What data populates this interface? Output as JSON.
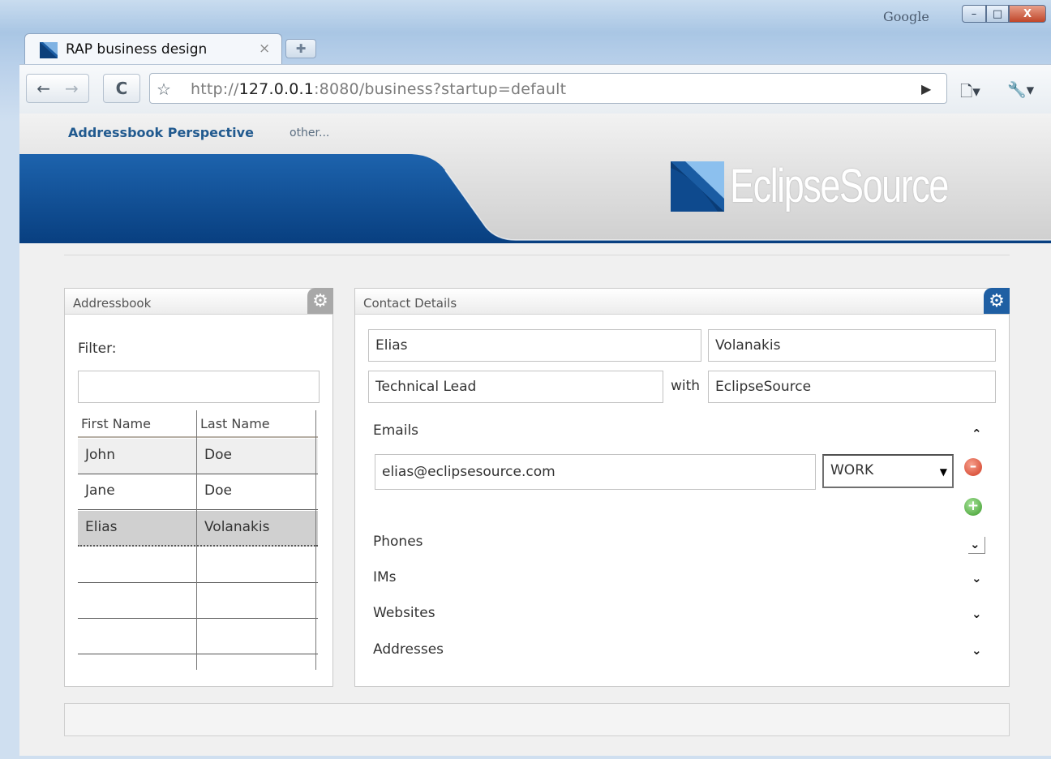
{
  "window": {
    "title_text": "Google",
    "controls": {
      "minimize": "–",
      "maximize": "□",
      "close": "X"
    }
  },
  "tab": {
    "title": "RAP business design",
    "close": "×",
    "new_tab": "✚"
  },
  "toolbar": {
    "back": "←",
    "forward": "→",
    "reload": "C",
    "star": "☆",
    "url_scheme": "http://",
    "url_host": "127.0.0.1",
    "url_rest": ":8080/business?startup=default",
    "go": "▶",
    "page_menu": "🗋▾",
    "wrench_menu": "🔧▾"
  },
  "header": {
    "perspective_link": "Addressbook Perspective",
    "other_link": "other...",
    "logo": "EclipseSource",
    "colors": {
      "banner_blue": "#0a4f96",
      "header_gray": "#d6d6d6"
    }
  },
  "addressbook": {
    "title": "Addressbook",
    "filter_label": "Filter:",
    "filter_value": "",
    "columns": [
      "First Name",
      "Last Name"
    ],
    "rows": [
      {
        "first": "John",
        "last": "Doe"
      },
      {
        "first": "Jane",
        "last": "Doe"
      },
      {
        "first": "Elias",
        "last": "Volanakis"
      }
    ],
    "selected_row": 2
  },
  "contact": {
    "title": "Contact Details",
    "first_name": "Elias",
    "last_name": "Volanakis",
    "job_title": "Technical Lead",
    "with_label": "with",
    "company": "EclipseSource",
    "emails_label": "Emails",
    "email_value": "elias@eclipsesource.com",
    "email_type": "WORK",
    "sections": [
      "Phones",
      "IMs",
      "Websites",
      "Addresses"
    ],
    "chev_up": "⌃",
    "chev_down": "⌄"
  }
}
